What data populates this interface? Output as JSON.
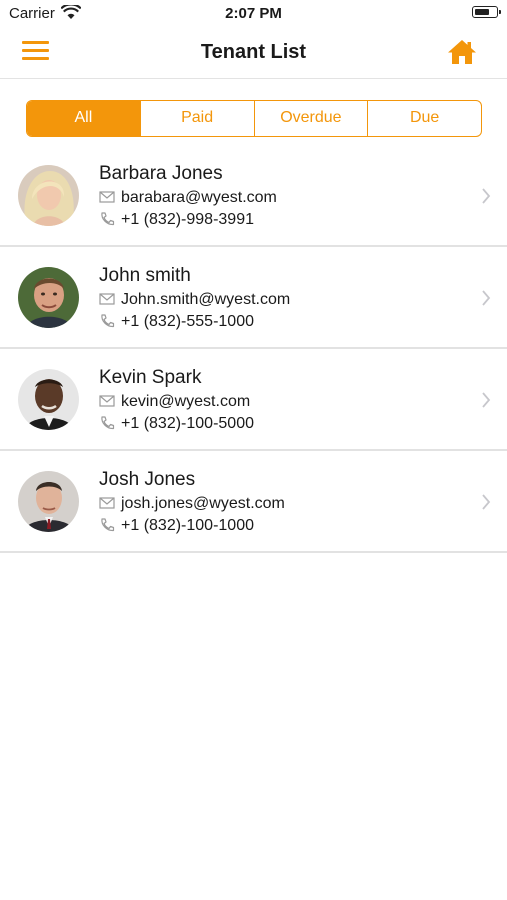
{
  "status_bar": {
    "carrier": "Carrier",
    "time": "2:07 PM",
    "battery_level": 0.7
  },
  "nav": {
    "title": "Tenant List",
    "left_icon": "menu-icon",
    "right_icon": "home-icon"
  },
  "colors": {
    "accent": "#f3960b",
    "divider": "#e2e2e2"
  },
  "filter_tabs": [
    {
      "label": "All",
      "selected": true
    },
    {
      "label": "Paid",
      "selected": false
    },
    {
      "label": "Overdue",
      "selected": false
    },
    {
      "label": "Due",
      "selected": false
    }
  ],
  "tenants": [
    {
      "name": "Barbara Jones",
      "email": "barabara@wyest.com",
      "phone": "+1  (832)-998-3991"
    },
    {
      "name": "John smith",
      "email": "John.smith@wyest.com",
      "phone": "+1 (832)-555-1000"
    },
    {
      "name": "Kevin Spark",
      "email": "kevin@wyest.com",
      "phone": "+1 (832)-100-5000"
    },
    {
      "name": "Josh Jones",
      "email": "josh.jones@wyest.com",
      "phone": "+1 (832)-100-1000"
    }
  ]
}
